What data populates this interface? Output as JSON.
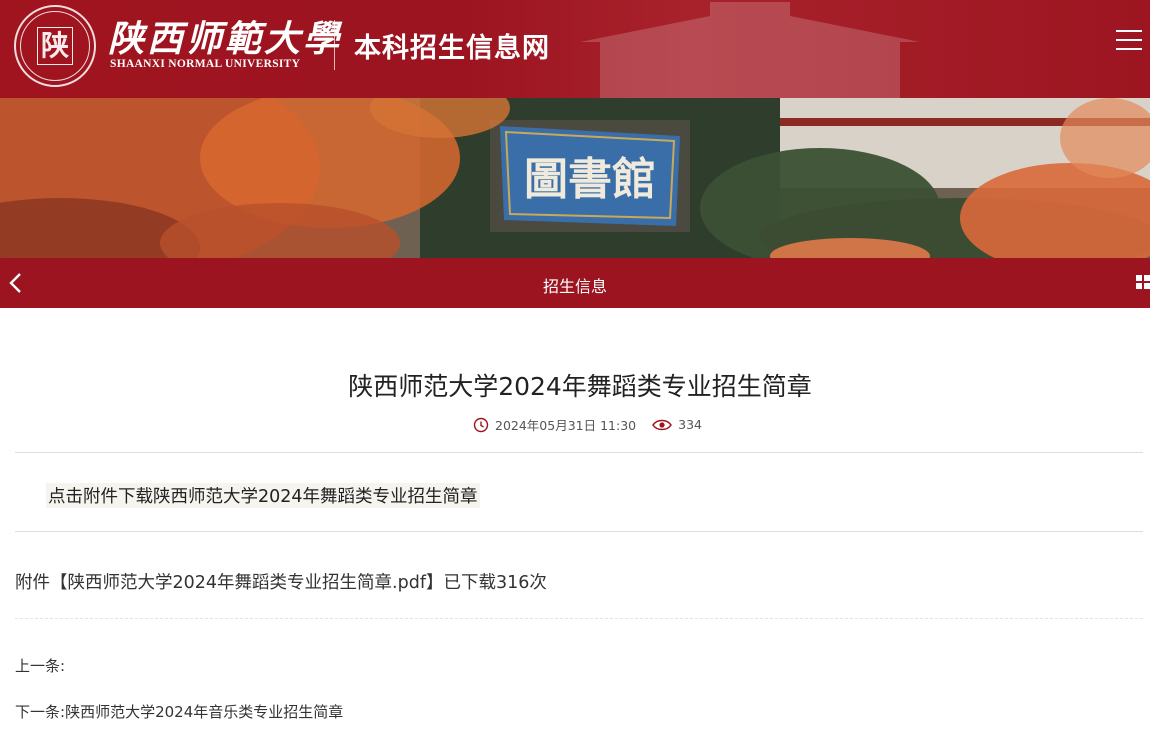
{
  "header": {
    "seal_char": "陕",
    "university_cn": "陕西师範大學",
    "university_en": "SHAANXI NORMAL UNIVERSITY",
    "site_title": "本科招生信息网",
    "menu_icon": "hamburger-menu-icon"
  },
  "banner": {
    "sign_text": "圖書館"
  },
  "navbar": {
    "back_icon": "chevron-left-icon",
    "title": "招生信息",
    "grid_icon": "grid-icon"
  },
  "article": {
    "title": "陕西师范大学2024年舞蹈类专业招生简章",
    "date": "2024年05月31日 11:30",
    "views": "334",
    "body_text": "点击附件下载陕西师范大学2024年舞蹈类专业招生简章",
    "attachment_prefix": "附件【",
    "attachment_name": "陕西师范大学2024年舞蹈类专业招生简章.pdf",
    "attachment_suffix": "】已下载316次",
    "prev_label": "上一条:",
    "prev_link": "",
    "next_label": "下一条:",
    "next_link": "陕西师范大学2024年音乐类专业招生简章"
  },
  "colors": {
    "brand_red": "#9c1420",
    "icon_red": "#9c1420"
  }
}
